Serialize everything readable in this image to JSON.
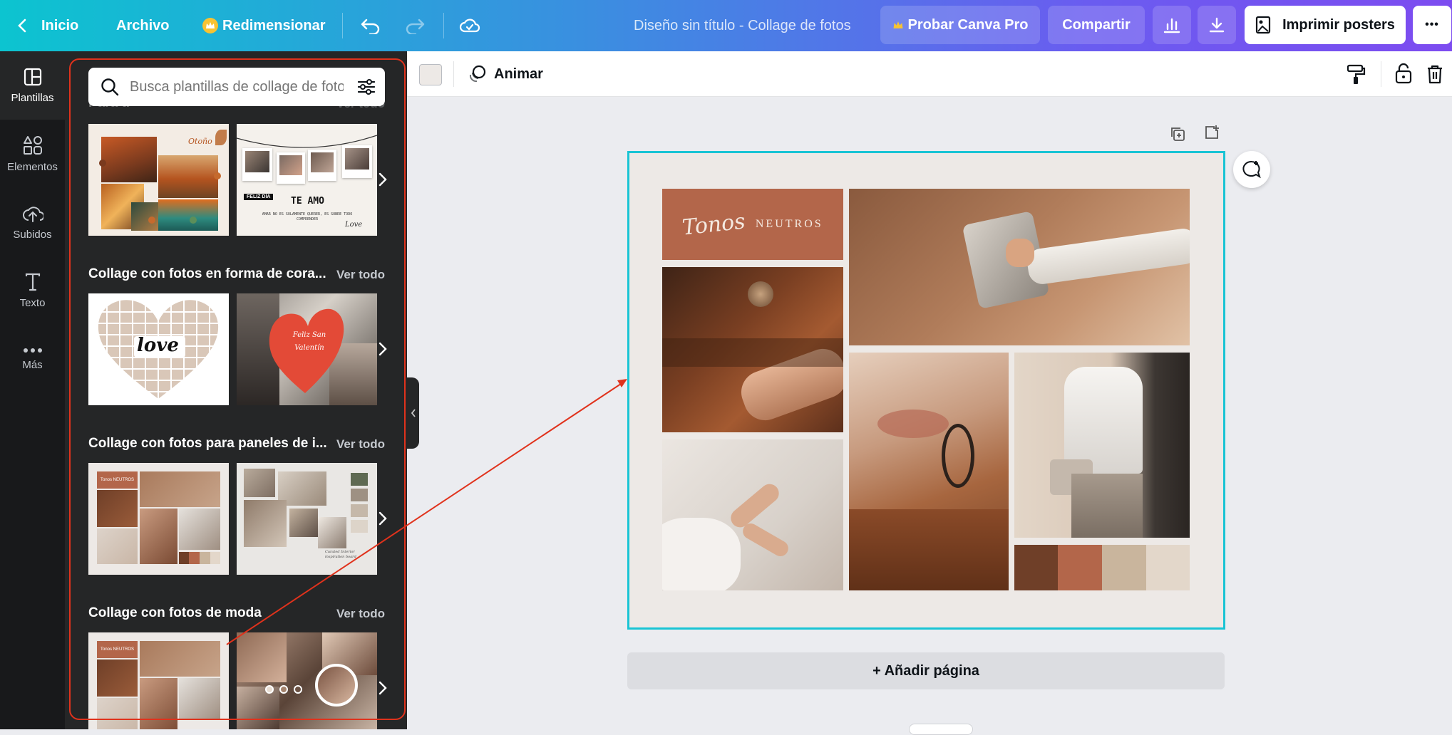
{
  "topbar": {
    "home_label": "Inicio",
    "file_label": "Archivo",
    "resize_label": "Redimensionar",
    "doc_title": "Diseño sin título - Collage de fotos",
    "try_pro_label": "Probar Canva Pro",
    "share_label": "Compartir",
    "print_label": "Imprimir posters",
    "more_label": "•••"
  },
  "rail": {
    "items": [
      {
        "label": "Plantillas",
        "icon": "templates-icon"
      },
      {
        "label": "Elementos",
        "icon": "elements-icon"
      },
      {
        "label": "Subidos",
        "icon": "upload-icon"
      },
      {
        "label": "Texto",
        "icon": "text-icon"
      },
      {
        "label": "Más",
        "icon": "more-icon"
      }
    ]
  },
  "panel": {
    "search_placeholder": "Busca plantillas de collage de fotos",
    "sections": [
      {
        "title": "Para ti",
        "see_all": "Ver todo"
      },
      {
        "title": "Collage con fotos en forma de cora...",
        "see_all": "Ver todo"
      },
      {
        "title": "Collage con fotos para paneles de i...",
        "see_all": "Ver todo"
      },
      {
        "title": "Collage con fotos de moda",
        "see_all": "Ver todo"
      }
    ],
    "thumb_texts": {
      "autumn": "Otoño",
      "polaroid_1": "FELIZ DÍA",
      "polaroid_2": "TE AMO",
      "polaroid_3": "AMAR NO ES SOLAMENTE QUERER, ES SOBRE TODO COMPRENDER",
      "polaroid_sign": "Love",
      "heart_word": "love",
      "valentine": "Feliz San Valentín",
      "moodboard_mini": "Tonos NEUTROS",
      "interior_caption": "Curated Interior inspiration board"
    }
  },
  "toolbar": {
    "animate_label": "Animar"
  },
  "canvas": {
    "title_script": "Tonos",
    "title_caps": "NEUTROS",
    "palette": [
      "#6f3f28",
      "#b3664a",
      "#c9b59d",
      "#e3d7ca"
    ],
    "add_page_label": "+ Añadir página"
  },
  "colors": {
    "accent_cyan": "#19c4d4",
    "annotation_red": "#e0321c",
    "panel_bg": "#252627"
  }
}
